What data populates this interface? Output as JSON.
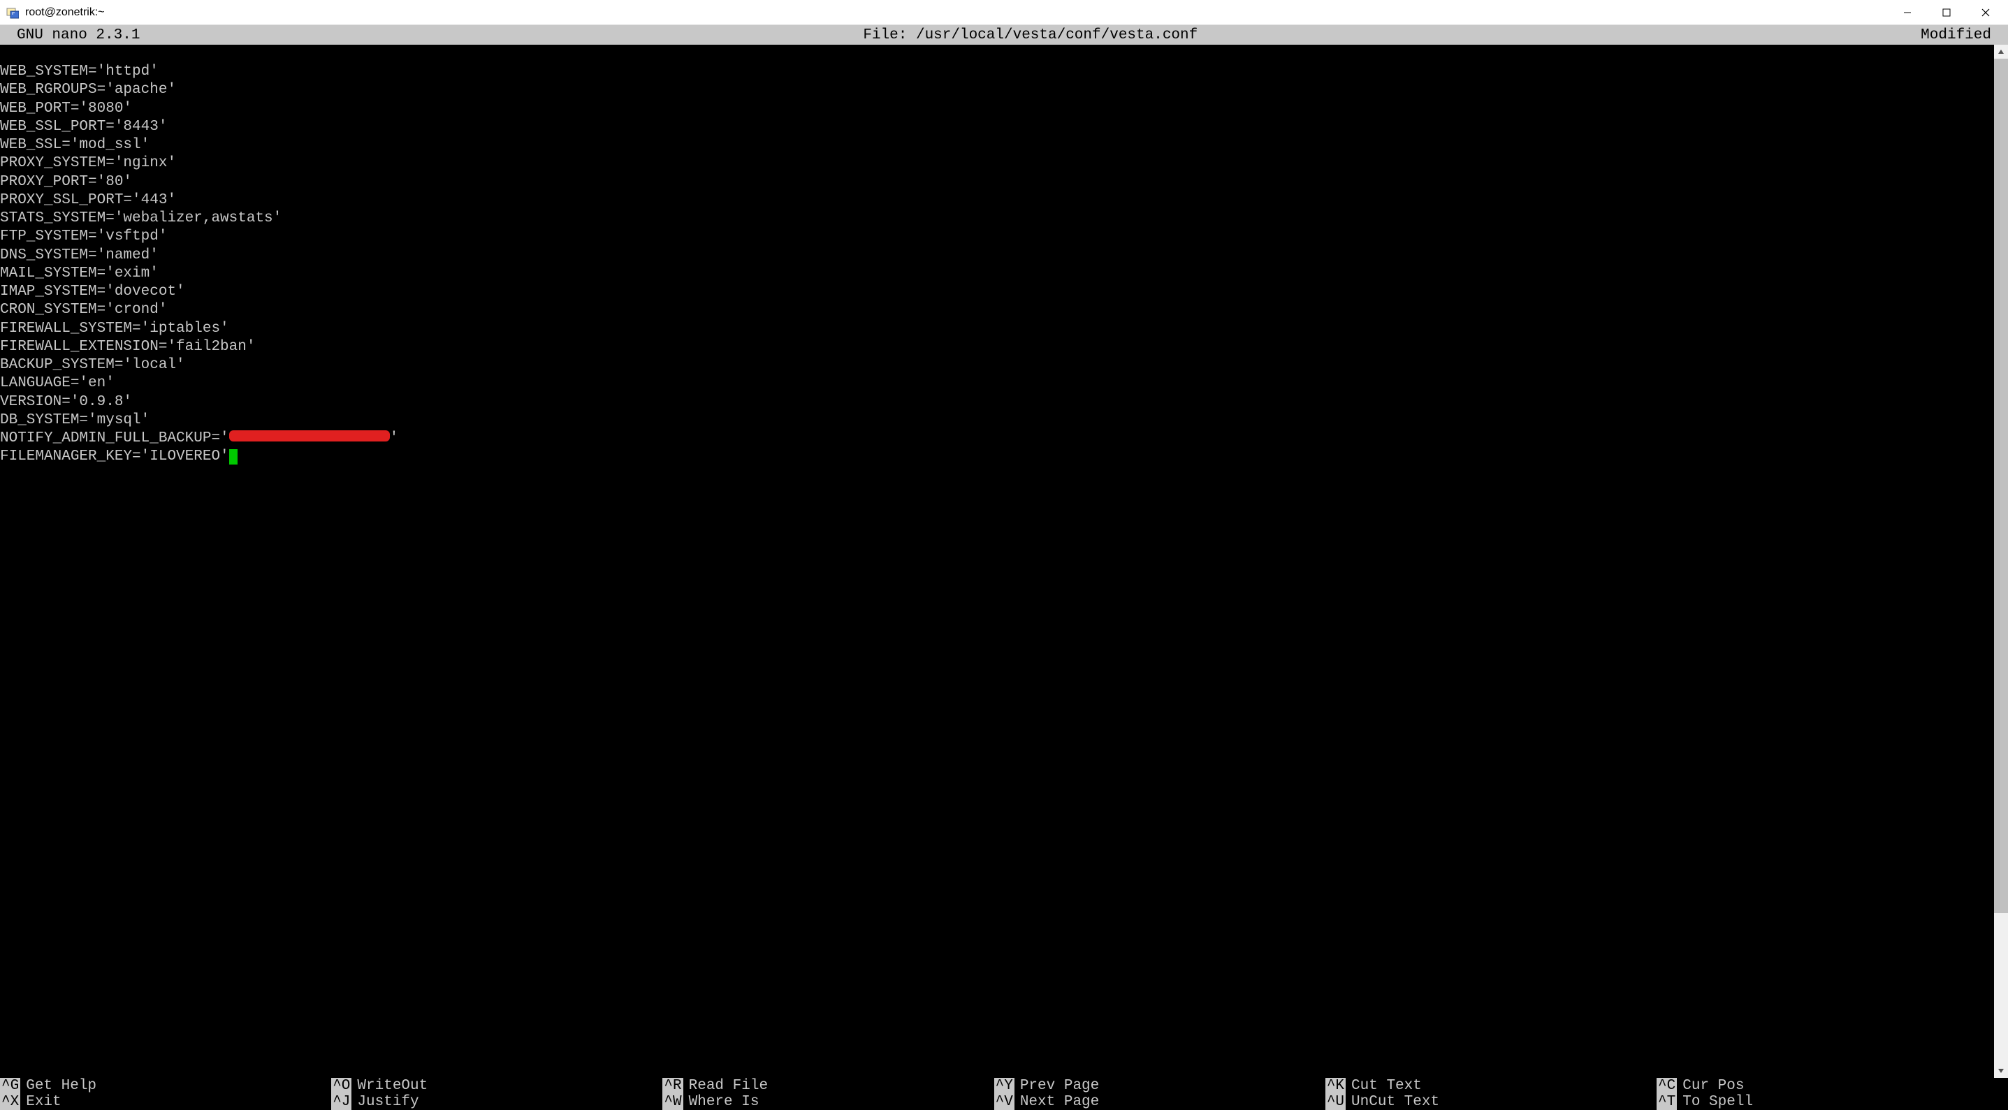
{
  "window": {
    "title": "root@zonetrik:~"
  },
  "nano": {
    "version_label": "GNU nano 2.3.1",
    "file_label": "File: /usr/local/vesta/conf/vesta.conf",
    "status": "Modified"
  },
  "content": {
    "lines": [
      "WEB_SYSTEM='httpd'",
      "WEB_RGROUPS='apache'",
      "WEB_PORT='8080'",
      "WEB_SSL_PORT='8443'",
      "WEB_SSL='mod_ssl'",
      "PROXY_SYSTEM='nginx'",
      "PROXY_PORT='80'",
      "PROXY_SSL_PORT='443'",
      "STATS_SYSTEM='webalizer,awstats'",
      "FTP_SYSTEM='vsftpd'",
      "DNS_SYSTEM='named'",
      "MAIL_SYSTEM='exim'",
      "IMAP_SYSTEM='dovecot'",
      "CRON_SYSTEM='crond'",
      "FIREWALL_SYSTEM='iptables'",
      "FIREWALL_EXTENSION='fail2ban'",
      "BACKUP_SYSTEM='local'",
      "LANGUAGE='en'",
      "VERSION='0.9.8'",
      "DB_SYSTEM='mysql'"
    ],
    "redacted_line_prefix": "NOTIFY_ADMIN_FULL_BACKUP='",
    "redacted_line_suffix": "'",
    "cursor_line": "FILEMANAGER_KEY='ILOVEREO'"
  },
  "shortcuts": {
    "row1": [
      {
        "key": "^G",
        "label": "Get Help"
      },
      {
        "key": "^O",
        "label": "WriteOut"
      },
      {
        "key": "^R",
        "label": "Read File"
      },
      {
        "key": "^Y",
        "label": "Prev Page"
      },
      {
        "key": "^K",
        "label": "Cut Text"
      },
      {
        "key": "^C",
        "label": "Cur Pos"
      }
    ],
    "row2": [
      {
        "key": "^X",
        "label": "Exit"
      },
      {
        "key": "^J",
        "label": "Justify"
      },
      {
        "key": "^W",
        "label": "Where Is"
      },
      {
        "key": "^V",
        "label": "Next Page"
      },
      {
        "key": "^U",
        "label": "UnCut Text"
      },
      {
        "key": "^T",
        "label": "To Spell"
      }
    ]
  }
}
